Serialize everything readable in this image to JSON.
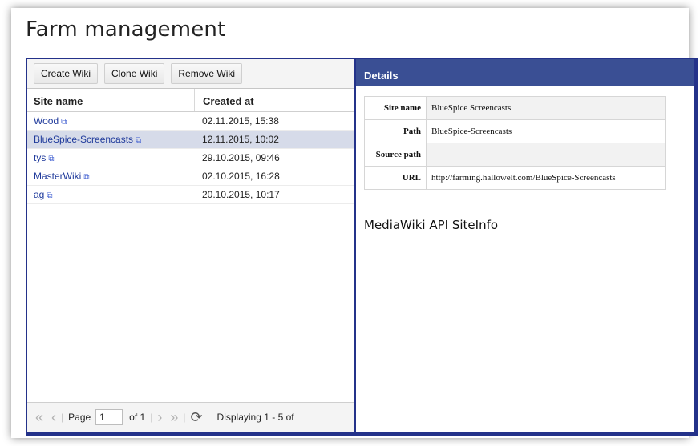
{
  "page": {
    "title": "Farm management"
  },
  "toolbar": {
    "buttons": [
      {
        "label": "Create Wiki"
      },
      {
        "label": "Clone Wiki"
      },
      {
        "label": "Remove Wiki"
      }
    ]
  },
  "grid": {
    "columns": [
      "Site name",
      "Created at"
    ],
    "rows": [
      {
        "site": "Wood",
        "created": "02.11.2015, 15:38",
        "selected": false
      },
      {
        "site": "BlueSpice-Screencasts",
        "created": "12.11.2015, 10:02",
        "selected": true
      },
      {
        "site": "tys",
        "created": "29.10.2015, 09:46",
        "selected": false
      },
      {
        "site": "MasterWiki",
        "created": "02.10.2015, 16:28",
        "selected": false
      },
      {
        "site": "ag",
        "created": "20.10.2015, 10:17",
        "selected": false
      }
    ]
  },
  "pager": {
    "page_label": "Page",
    "page_value": "1",
    "of_label": "of 1",
    "display_text": "Displaying 1 - 5 of"
  },
  "details": {
    "header": "Details",
    "fields": [
      {
        "key": "Site name",
        "value": "BlueSpice Screencasts"
      },
      {
        "key": "Path",
        "value": "BlueSpice-Screencasts"
      },
      {
        "key": "Source path",
        "value": ""
      },
      {
        "key": "URL",
        "value": "http://farming.hallowelt.com/BlueSpice-Screencasts"
      }
    ],
    "siteinfo_title": "MediaWiki API SiteInfo"
  },
  "colors": {
    "panel_border": "#24328a",
    "details_header": "#3a4f94",
    "selected_row": "#d6dbe9",
    "link": "#1f3a9b"
  }
}
